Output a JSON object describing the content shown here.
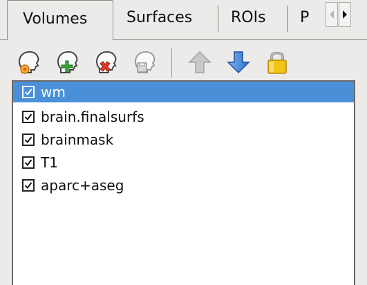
{
  "tabs": [
    {
      "label": "Volumes",
      "active": true
    },
    {
      "label": "Surfaces",
      "active": false
    },
    {
      "label": "ROIs",
      "active": false
    },
    {
      "label": "P",
      "active": false
    }
  ],
  "tab_scroll": {
    "left_icon": "arrow-left-icon",
    "right_icon": "arrow-right-icon"
  },
  "toolbar": [
    {
      "icon": "load-volume-icon"
    },
    {
      "icon": "new-volume-icon"
    },
    {
      "icon": "close-volume-icon"
    },
    {
      "icon": "save-volume-icon"
    },
    {
      "icon": "move-up-icon"
    },
    {
      "icon": "move-down-icon"
    },
    {
      "icon": "lock-icon"
    }
  ],
  "layers": [
    {
      "label": "wm",
      "checked": true,
      "selected": true
    },
    {
      "label": "brain.finalsurfs",
      "checked": true,
      "selected": false
    },
    {
      "label": "brainmask",
      "checked": true,
      "selected": false
    },
    {
      "label": "T1",
      "checked": true,
      "selected": false
    },
    {
      "label": "aparc+aseg",
      "checked": true,
      "selected": false
    }
  ],
  "colors": {
    "selection": "#4a90d9",
    "panel_bg": "#ecebe9"
  }
}
